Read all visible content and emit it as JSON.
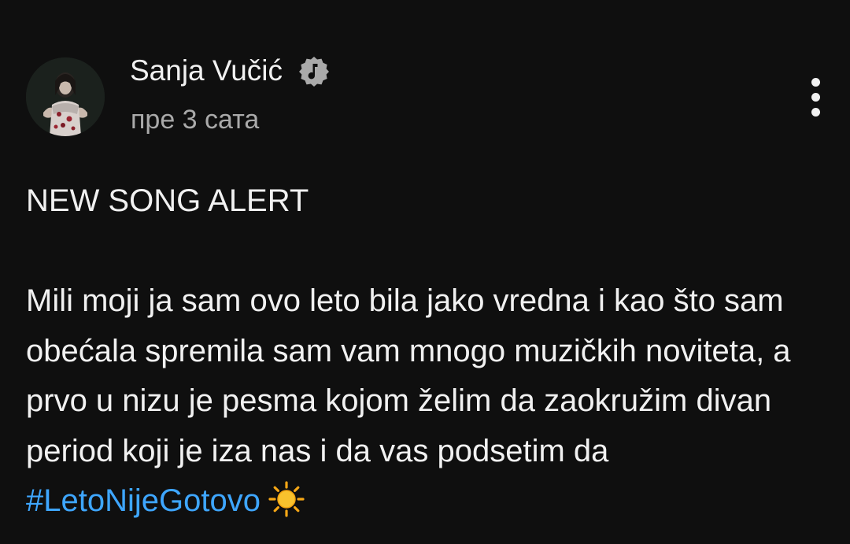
{
  "post": {
    "author": {
      "name": "Sanja Vučić",
      "avatar_icon": "avatar-photo",
      "badge_icon": "verified-music-note-icon"
    },
    "timestamp": "пре 3 сата",
    "menu_icon": "more-vert-icon",
    "content": {
      "headline": "NEW SONG ALERT",
      "paragraph_text": "Mili moji ja sam ovo leto bila jako vredna i kao što sam obećala spremila sam vam mnogo muzičkih noviteta, a prvo u nizu je pesma kojom želim da zaokružim divan period koji je iza nas i da vas podsetim da ",
      "hashtag": "#LetoNijeGotovo",
      "emoji": "☀️"
    }
  },
  "colors": {
    "background": "#0f0f0f",
    "text_primary": "#f1f1f1",
    "text_secondary": "#aaaaaa",
    "hashtag": "#3ea6ff"
  }
}
